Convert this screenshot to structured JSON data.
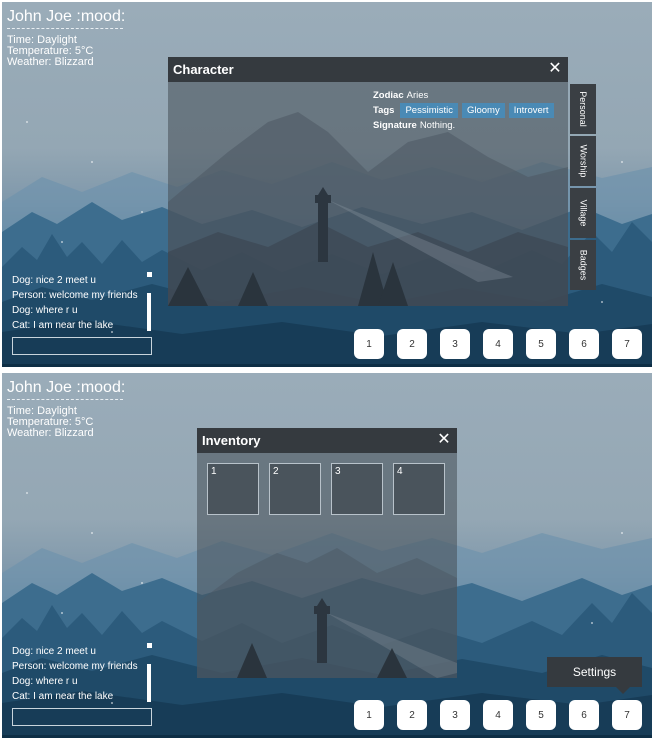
{
  "hud": {
    "player_name": "John Joe :mood:",
    "time": "Time: Daylight",
    "temperature": "Temperature: 5°C",
    "weather": "Weather: Blizzard"
  },
  "chat": {
    "messages": [
      "Dog: nice 2 meet u",
      "Person: welcome my friends",
      "Dog: where r u",
      "Cat: I am near the lake"
    ],
    "input_value": ""
  },
  "hotbar": {
    "slots": [
      "1",
      "2",
      "3",
      "4",
      "5",
      "6",
      "7"
    ]
  },
  "character_window": {
    "title": "Character",
    "close": "✕",
    "zodiac_label": "Zodiac",
    "zodiac_value": "Aries",
    "tags_label": "Tags",
    "tags": [
      "Pessimistic",
      "Gloomy",
      "Introvert"
    ],
    "signature_label": "Signature",
    "signature_value": "Nothing.",
    "side_tabs": [
      "Personal",
      "Worship",
      "Village",
      "Badges"
    ]
  },
  "inventory_window": {
    "title": "Inventory",
    "close": "✕",
    "slots": [
      "1",
      "2",
      "3",
      "4"
    ]
  },
  "settings_tooltip": "Settings",
  "colors": {
    "window_header": "#353a3f",
    "tag_bg": "#4a8ab5",
    "sky": "#9aacb9",
    "forest": "#1e4d6e"
  }
}
